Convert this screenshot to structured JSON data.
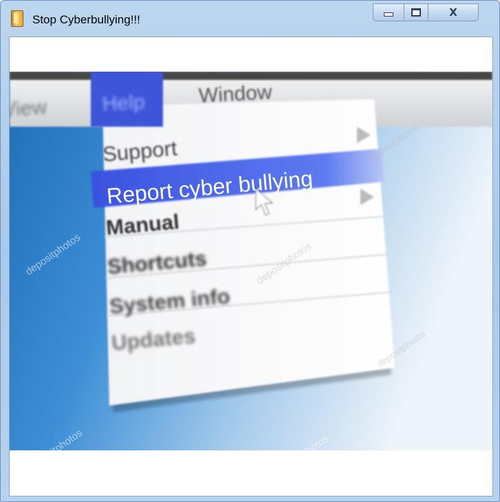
{
  "window": {
    "title": "Stop Cyberbullying!!!",
    "controls": {
      "minimize_icon": "minimize-icon",
      "maximize_icon": "maximize-icon",
      "close_icon": "close-icon"
    }
  },
  "image": {
    "menu_bar": [
      "View",
      "Help",
      "Window"
    ],
    "active_menu": "Help",
    "menu_items": [
      "Support",
      "Report cyber bullying",
      "Manual",
      "Shortcuts",
      "System info",
      "Updates"
    ],
    "highlighted_item": "Report cyber bullying",
    "watermark": "depositphotos"
  },
  "colors": {
    "accent": "#3c5ce0",
    "background_blue": "#2f7fc8"
  }
}
